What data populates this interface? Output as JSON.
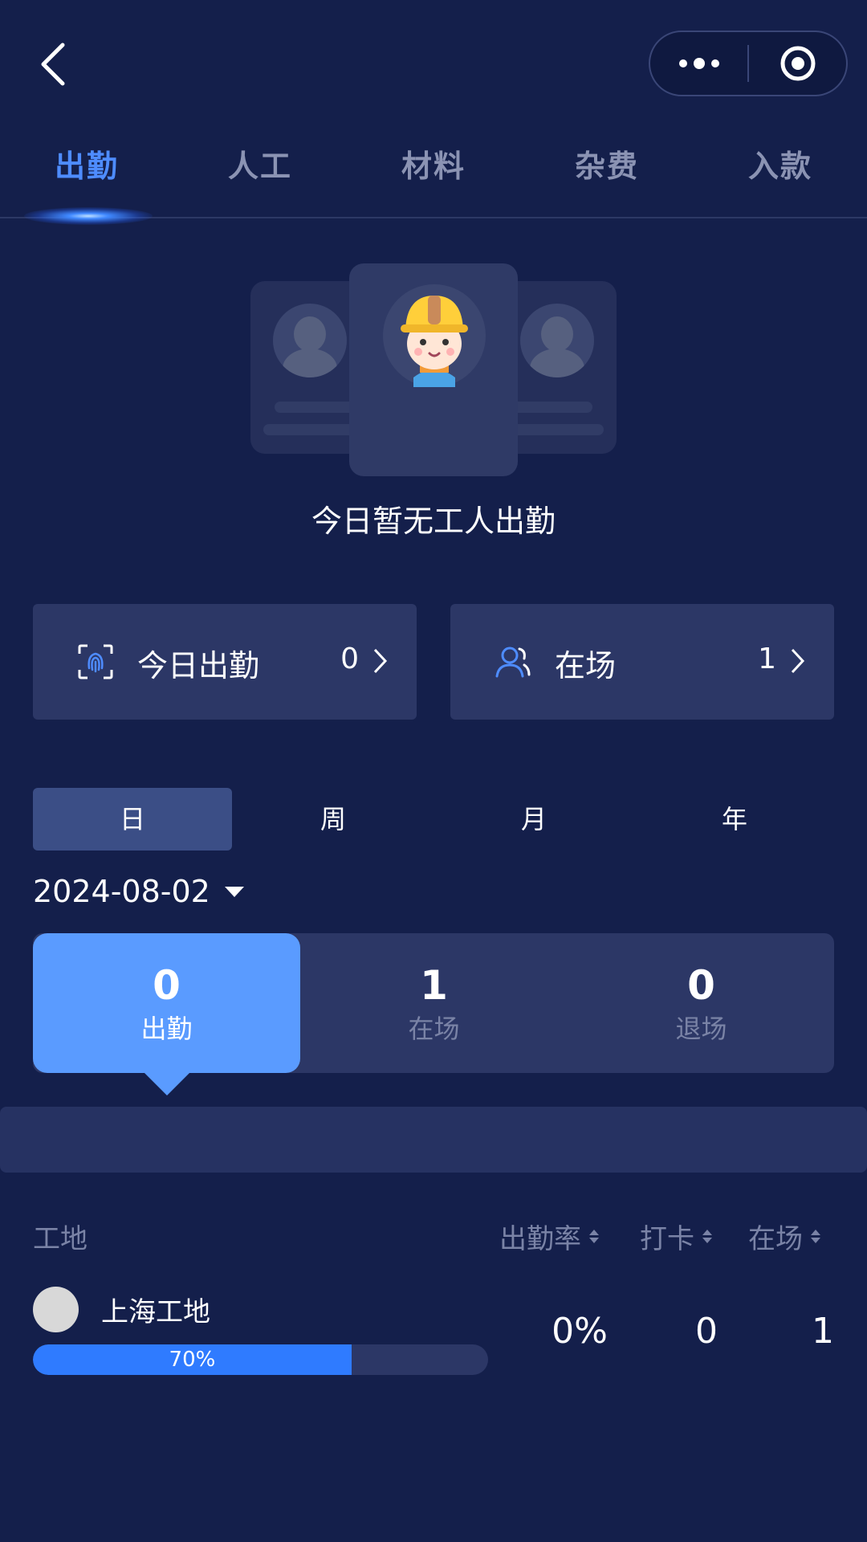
{
  "tabs": [
    {
      "label": "出勤",
      "active": true
    },
    {
      "label": "人工",
      "active": false
    },
    {
      "label": "材料",
      "active": false
    },
    {
      "label": "杂费",
      "active": false
    },
    {
      "label": "入款",
      "active": false
    }
  ],
  "empty_state": {
    "text": "今日暂无工人出勤"
  },
  "quick_cards": {
    "today_attendance": {
      "label": "今日出勤",
      "value": "0",
      "icon": "fingerprint-scan-icon"
    },
    "on_site": {
      "label": "在场",
      "value": "1",
      "icon": "users-icon"
    }
  },
  "period": {
    "options": [
      "日",
      "周",
      "月",
      "年"
    ],
    "selected": "日"
  },
  "date": {
    "value": "2024-08-02"
  },
  "stats": [
    {
      "value": "0",
      "label": "出勤",
      "active": true
    },
    {
      "value": "1",
      "label": "在场",
      "active": false
    },
    {
      "value": "0",
      "label": "退场",
      "active": false
    }
  ],
  "table": {
    "headers": {
      "site": "工地",
      "rate": "出勤率",
      "checkin": "打卡",
      "onsite": "在场"
    },
    "rows": [
      {
        "site": "上海工地",
        "progress_label": "70%",
        "progress": 0.7,
        "rate": "0%",
        "checkin": "0",
        "onsite": "1"
      }
    ]
  },
  "colors": {
    "background": "#141f4b",
    "accent": "#4e8cff",
    "card": "#2c3766",
    "active_stat": "#5a9bff",
    "progress": "#2f7bff"
  }
}
